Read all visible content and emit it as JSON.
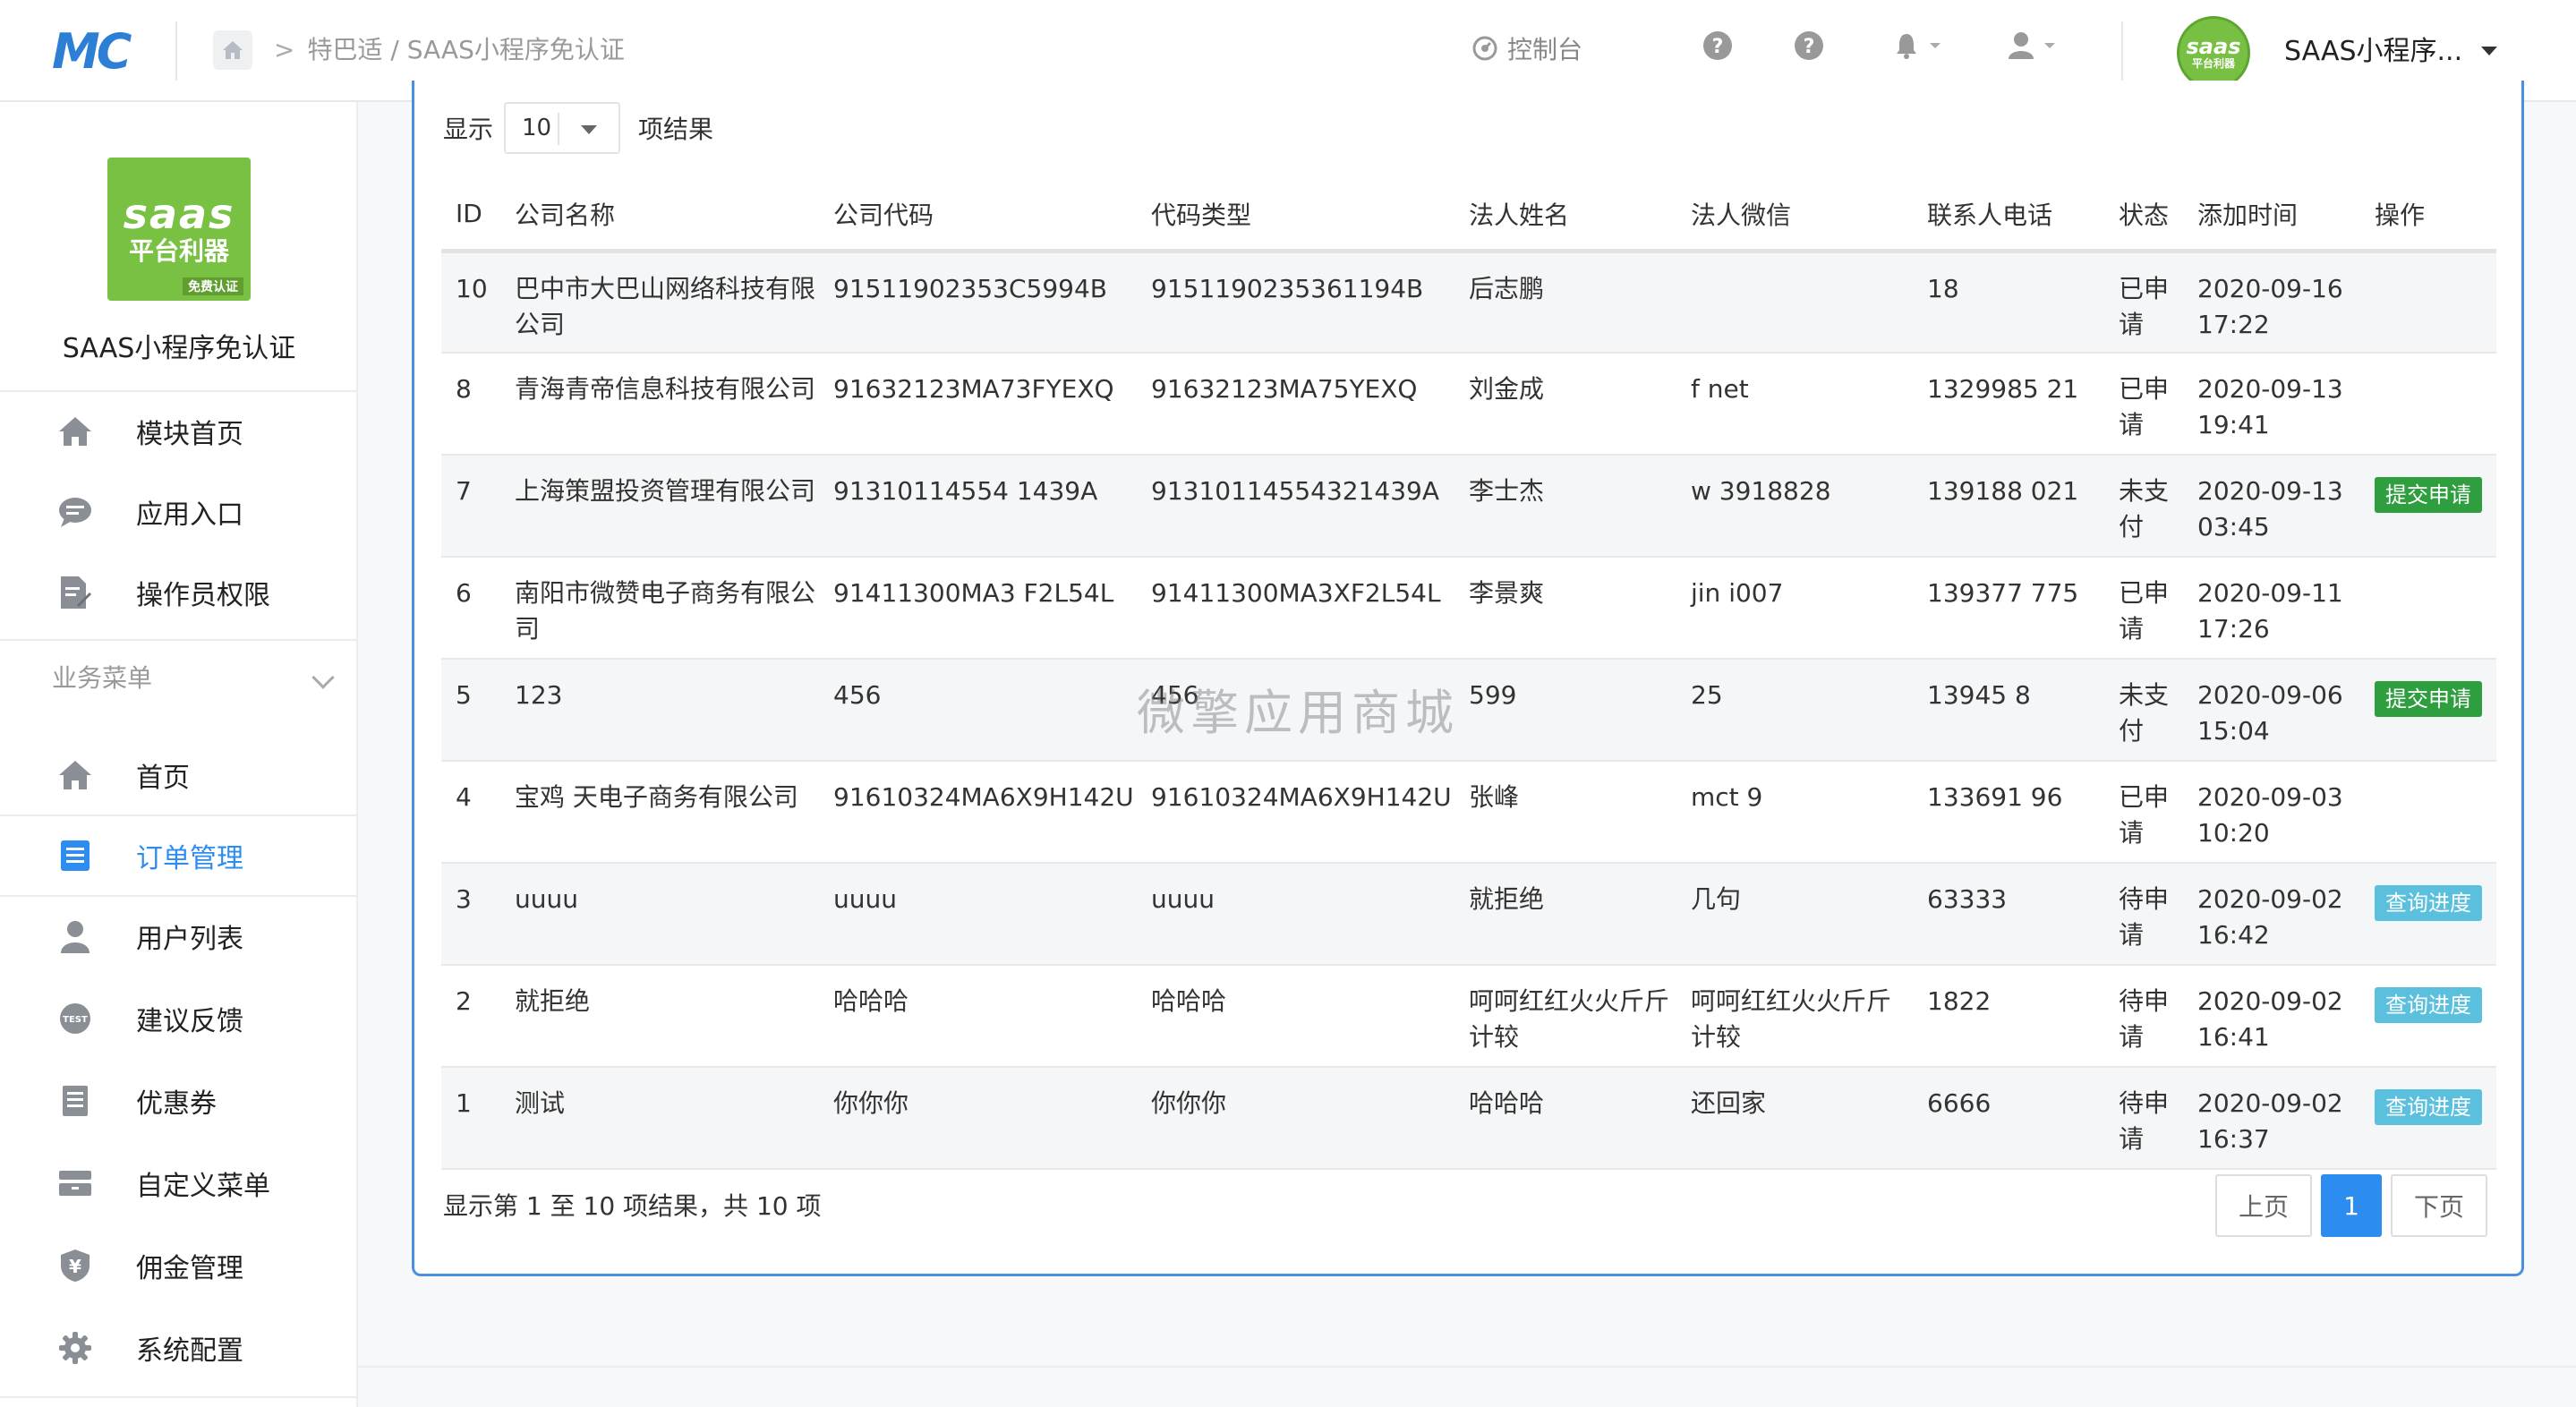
{
  "header": {
    "logo_text": "MC",
    "breadcrumb": "特巴适 / SAAS小程序免认证",
    "console_label": "控制台",
    "avatar_top": "saas",
    "avatar_bottom": "平台利器",
    "account_name": "SAAS小程序..."
  },
  "sidebar": {
    "brand_logo_line1": "saas",
    "brand_logo_line2": "平台利器",
    "brand_logo_tag": "免费认证",
    "brand_name": "SAAS小程序免认证",
    "top_items": [
      {
        "label": "模块首页",
        "icon": "home-icon"
      },
      {
        "label": "应用入口",
        "icon": "chat-bubble-icon"
      },
      {
        "label": "操作员权限",
        "icon": "edit-document-icon"
      }
    ],
    "section_title": "业务菜单",
    "items": [
      {
        "label": "首页",
        "icon": "home-icon"
      },
      {
        "label": "订单管理",
        "icon": "list-icon"
      },
      {
        "label": "用户列表",
        "icon": "user-icon"
      },
      {
        "label": "建议反馈",
        "icon": "test-badge-icon"
      },
      {
        "label": "优惠券",
        "icon": "coupon-icon"
      },
      {
        "label": "自定义菜单",
        "icon": "drawer-icon"
      },
      {
        "label": "佣金管理",
        "icon": "yen-shield-icon"
      },
      {
        "label": "系统配置",
        "icon": "gear-icon"
      }
    ],
    "accent_color": "#2d8cf0"
  },
  "table_controls": {
    "show_label": "显示",
    "page_length": "10",
    "result_suffix": "项结果"
  },
  "table": {
    "columns": [
      "ID",
      "公司名称",
      "公司代码",
      "代码类型",
      "法人姓名",
      "法人微信",
      "联系人电话",
      "状态",
      "添加时间",
      "操作"
    ],
    "rows": [
      {
        "id": "10",
        "name": "巴中市大巴山网络科技有限公司",
        "code": "91511902353C5994B",
        "type": "9151190235361194B",
        "legal": "后志鹏",
        "wechat": "",
        "phone": "18",
        "status": "已申请",
        "time": "2020-09-16 17:22",
        "op": ""
      },
      {
        "id": "8",
        "name": "青海青帝信息科技有限公司",
        "code": "91632123MA73FYEXQ",
        "type": "91632123MA75YEXQ",
        "legal": "刘金成",
        "wechat": "f  net",
        "phone": "1329985 21",
        "status": "已申请",
        "time": "2020-09-13 19:41",
        "op": ""
      },
      {
        "id": "7",
        "name": "上海策盟投资管理有限公司",
        "code": "91310114554 1439A",
        "type": "91310114554321439A",
        "legal": "李士杰",
        "wechat": "w  3918828",
        "phone": "139188 021",
        "status": "未支付",
        "time": "2020-09-13 03:45",
        "op": "提交申请"
      },
      {
        "id": "6",
        "name": "南阳市微赞电子商务有限公司",
        "code": "91411300MA3 F2L54L",
        "type": "91411300MA3XF2L54L",
        "legal": "李景爽",
        "wechat": "jin i007",
        "phone": "139377  775",
        "status": "已申请",
        "time": "2020-09-11 17:26",
        "op": ""
      },
      {
        "id": "5",
        "name": "123",
        "code": "456",
        "type": "456",
        "legal": "599",
        "wechat": "25",
        "phone": "13945  8",
        "status": "未支付",
        "time": "2020-09-06 15:04",
        "op": "提交申请"
      },
      {
        "id": "4",
        "name": "宝鸡 天电子商务有限公司",
        "code": "91610324MA6X9H142U",
        "type": "91610324MA6X9H142U",
        "legal": "张峰",
        "wechat": "mct  9",
        "phone": "133691  96",
        "status": "已申请",
        "time": "2020-09-03 10:20",
        "op": ""
      },
      {
        "id": "3",
        "name": "uuuu",
        "code": "uuuu",
        "type": "uuuu",
        "legal": "就拒绝",
        "wechat": "几句",
        "phone": "63333",
        "status": "待申请",
        "time": "2020-09-02 16:42",
        "op": "查询进度"
      },
      {
        "id": "2",
        "name": "就拒绝",
        "code": "哈哈哈",
        "type": "哈哈哈",
        "legal": "呵呵红红火火斤斤计较",
        "wechat": "呵呵红红火火斤斤计较",
        "phone": "1822",
        "status": "待申请",
        "time": "2020-09-02 16:41",
        "op": "查询进度"
      },
      {
        "id": "1",
        "name": "测试",
        "code": "你你你",
        "type": "你你你",
        "legal": "哈哈哈",
        "wechat": "还回家",
        "phone": "6666",
        "status": "待申请",
        "time": "2020-09-02 16:37",
        "op": "查询进度"
      }
    ]
  },
  "footer": {
    "info": "显示第 1 至 10 项结果，共 10 项",
    "prev": "上页",
    "current": "1",
    "next": "下页"
  },
  "watermark": "微擎应用商城"
}
